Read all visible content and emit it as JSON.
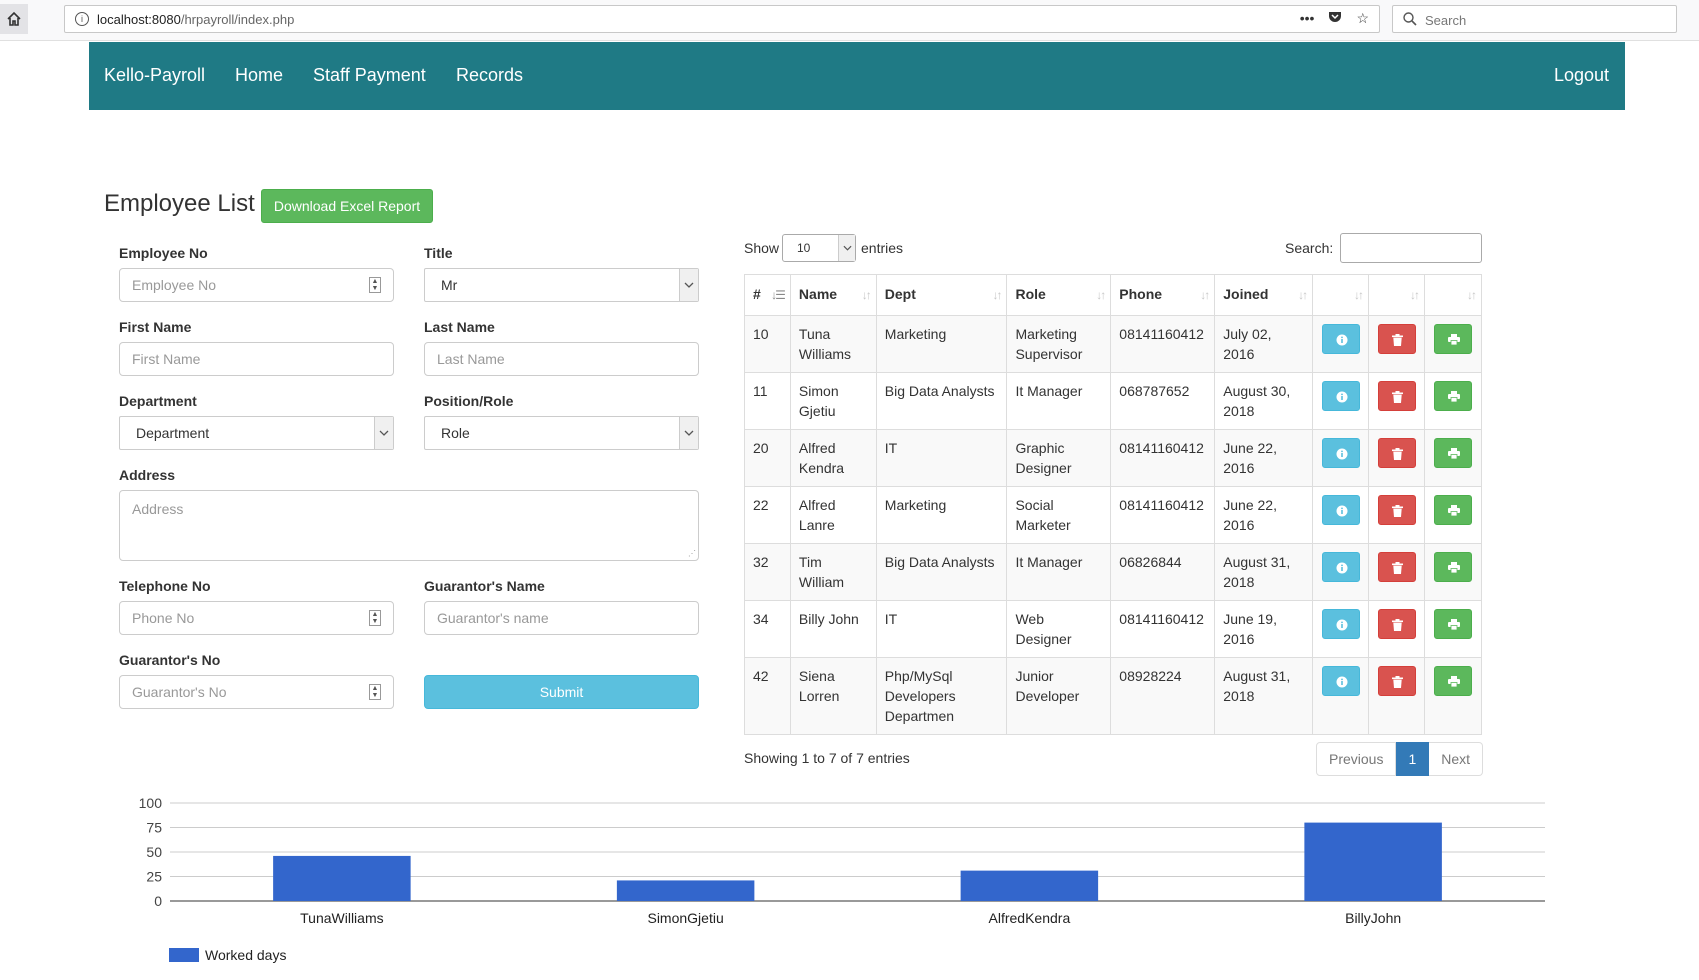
{
  "browser": {
    "url_host": "localhost:8080",
    "url_path": "/hrpayroll/index.php",
    "search_placeholder": "Search"
  },
  "nav": {
    "brand": "Kello-Payroll",
    "items": [
      "Home",
      "Staff Payment",
      "Records"
    ],
    "logout": "Logout"
  },
  "page": {
    "title": "Employee List",
    "excel_button": "Download Excel Report"
  },
  "form": {
    "employee_no": {
      "label": "Employee No",
      "placeholder": "Employee No"
    },
    "title": {
      "label": "Title",
      "value": "Mr"
    },
    "first_name": {
      "label": "First Name",
      "placeholder": "First Name"
    },
    "last_name": {
      "label": "Last Name",
      "placeholder": "Last Name"
    },
    "department": {
      "label": "Department",
      "value": "Department"
    },
    "position": {
      "label": "Position/Role",
      "value": "Role"
    },
    "address": {
      "label": "Address",
      "placeholder": "Address"
    },
    "telephone": {
      "label": "Telephone No",
      "placeholder": "Phone No"
    },
    "guarantor_name": {
      "label": "Guarantor's Name",
      "placeholder": "Guarantor's name"
    },
    "guarantor_no": {
      "label": "Guarantor's No",
      "placeholder": "Guarantor's No"
    },
    "submit": "Submit"
  },
  "table": {
    "show_label": "Show",
    "entries_value": "10",
    "entries_label": "entries",
    "search_label": "Search:",
    "headers": [
      "#",
      "Name",
      "Dept",
      "Role",
      "Phone",
      "Joined"
    ],
    "rows": [
      {
        "id": "10",
        "name": "Tuna Williams",
        "dept": "Marketing",
        "role": "Marketing Supervisor",
        "phone": "08141160412",
        "joined": "July 02, 2016"
      },
      {
        "id": "11",
        "name": "Simon Gjetiu",
        "dept": "Big Data Analysts",
        "role": "It Manager",
        "phone": "068787652",
        "joined": "August 30, 2018"
      },
      {
        "id": "20",
        "name": "Alfred Kendra",
        "dept": "IT",
        "role": "Graphic Designer",
        "phone": "08141160412",
        "joined": "June 22, 2016"
      },
      {
        "id": "22",
        "name": "Alfred Lanre",
        "dept": "Marketing",
        "role": "Social Marketer",
        "phone": "08141160412",
        "joined": "June 22, 2016"
      },
      {
        "id": "32",
        "name": "Tim William",
        "dept": "Big Data Analysts",
        "role": "It Manager",
        "phone": "06826844",
        "joined": "August 31, 2018"
      },
      {
        "id": "34",
        "name": "Billy John",
        "dept": "IT",
        "role": "Web Designer",
        "phone": "08141160412",
        "joined": "June 19, 2016"
      },
      {
        "id": "42",
        "name": "Siena Lorren",
        "dept": "Php/MySql Developers Departmen",
        "role": "Junior Developer",
        "phone": "08928224",
        "joined": "August 31, 2018"
      }
    ],
    "showing": "Showing 1 to 7 of 7 entries",
    "pager": {
      "prev": "Previous",
      "current": "1",
      "next": "Next"
    }
  },
  "colors": {
    "navbar": "#1f7a85",
    "info": "#5bc0de",
    "danger": "#d9534f",
    "success": "#5cb85c",
    "primary": "#337ab7",
    "bar": "#3366cc"
  },
  "chart_data": {
    "type": "bar",
    "categories": [
      "TunaWilliams",
      "SimonGjetiu",
      "AlfredKendra",
      "BillyJohn"
    ],
    "series": [
      {
        "name": "Worked days",
        "values": [
          46,
          21,
          31,
          80
        ]
      }
    ],
    "ylim": [
      0,
      100
    ],
    "yticks": [
      0,
      25,
      50,
      75,
      100
    ],
    "grid": true,
    "legend": "bottom-left"
  }
}
